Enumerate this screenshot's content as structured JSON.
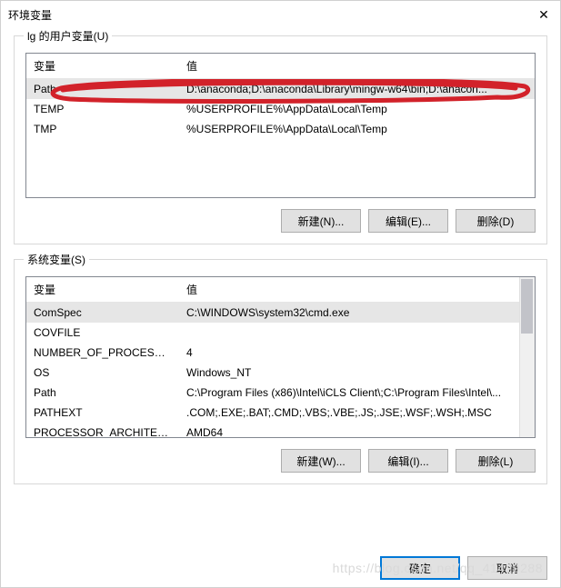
{
  "titlebar": {
    "title": "环境变量"
  },
  "user_section": {
    "label": "lg 的用户变量(U)",
    "columns": {
      "name": "变量",
      "value": "值"
    },
    "rows": [
      {
        "name": "Path",
        "value": "D:\\anaconda;D:\\anaconda\\Library\\mingw-w64\\bin;D:\\anacon...",
        "selected": true
      },
      {
        "name": "TEMP",
        "value": "%USERPROFILE%\\AppData\\Local\\Temp",
        "selected": false
      },
      {
        "name": "TMP",
        "value": "%USERPROFILE%\\AppData\\Local\\Temp",
        "selected": false
      }
    ],
    "buttons": {
      "new": "新建(N)...",
      "edit": "编辑(E)...",
      "delete": "删除(D)"
    }
  },
  "system_section": {
    "label": "系统变量(S)",
    "columns": {
      "name": "变量",
      "value": "值"
    },
    "rows": [
      {
        "name": "ComSpec",
        "value": "C:\\WINDOWS\\system32\\cmd.exe",
        "selected": true
      },
      {
        "name": "COVFILE",
        "value": ""
      },
      {
        "name": "NUMBER_OF_PROCESSORS",
        "value": "4"
      },
      {
        "name": "OS",
        "value": "Windows_NT"
      },
      {
        "name": "Path",
        "value": "C:\\Program Files (x86)\\Intel\\iCLS Client\\;C:\\Program Files\\Intel\\..."
      },
      {
        "name": "PATHEXT",
        "value": ".COM;.EXE;.BAT;.CMD;.VBS;.VBE;.JS;.JSE;.WSF;.WSH;.MSC"
      },
      {
        "name": "PROCESSOR_ARCHITECT...",
        "value": "AMD64"
      }
    ],
    "buttons": {
      "new": "新建(W)...",
      "edit": "编辑(I)...",
      "delete": "删除(L)"
    }
  },
  "footer": {
    "ok": "确定",
    "cancel": "取消"
  },
  "watermark": "https://blog.csdn.net/qq_41429288",
  "annotation": {
    "color": "#d2222a"
  }
}
